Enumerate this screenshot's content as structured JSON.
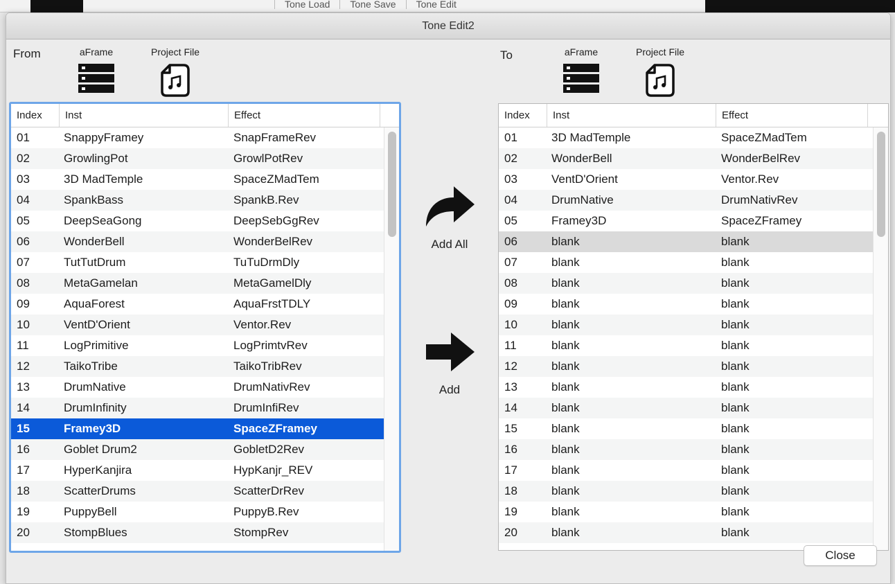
{
  "background": {
    "menu": [
      "Tone Load",
      "Tone Save",
      "Tone Edit"
    ]
  },
  "window": {
    "title": "Tone Edit2"
  },
  "from": {
    "label": "From",
    "aframe_label": "aFrame",
    "project_label": "Project File",
    "columns": [
      "Index",
      "Inst",
      "Effect"
    ],
    "selected_index": "15",
    "rows": [
      {
        "idx": "01",
        "inst": "SnappyFramey",
        "effect": "SnapFrameRev"
      },
      {
        "idx": "02",
        "inst": "GrowlingPot",
        "effect": "GrowlPotRev"
      },
      {
        "idx": "03",
        "inst": "3D MadTemple",
        "effect": "SpaceZMadTem"
      },
      {
        "idx": "04",
        "inst": "SpankBass",
        "effect": "SpankB.Rev"
      },
      {
        "idx": "05",
        "inst": "DeepSeaGong",
        "effect": "DeepSebGgRev"
      },
      {
        "idx": "06",
        "inst": "WonderBell",
        "effect": "WonderBelRev"
      },
      {
        "idx": "07",
        "inst": "TutTutDrum",
        "effect": "TuTuDrmDly"
      },
      {
        "idx": "08",
        "inst": "MetaGamelan",
        "effect": "MetaGamelDly"
      },
      {
        "idx": "09",
        "inst": "AquaForest",
        "effect": "AquaFrstTDLY"
      },
      {
        "idx": "10",
        "inst": "VentD'Orient",
        "effect": "Ventor.Rev"
      },
      {
        "idx": "11",
        "inst": "LogPrimitive",
        "effect": "LogPrimtvRev"
      },
      {
        "idx": "12",
        "inst": "TaikoTribe",
        "effect": "TaikoTribRev"
      },
      {
        "idx": "13",
        "inst": "DrumNative",
        "effect": "DrumNativRev"
      },
      {
        "idx": "14",
        "inst": "DrumInfinity",
        "effect": "DrumInfiRev"
      },
      {
        "idx": "15",
        "inst": "Framey3D",
        "effect": "SpaceZFramey"
      },
      {
        "idx": "16",
        "inst": "Goblet Drum2",
        "effect": "GobletD2Rev"
      },
      {
        "idx": "17",
        "inst": "HyperKanjira",
        "effect": "HypKanjr_REV"
      },
      {
        "idx": "18",
        "inst": "ScatterDrums",
        "effect": "ScatterDrRev"
      },
      {
        "idx": "19",
        "inst": "PuppyBell",
        "effect": "PuppyB.Rev"
      },
      {
        "idx": "20",
        "inst": "StompBlues",
        "effect": "StompRev"
      }
    ]
  },
  "to": {
    "label": "To",
    "aframe_label": "aFrame",
    "project_label": "Project File",
    "columns": [
      "Index",
      "Inst",
      "Effect"
    ],
    "highlighted_index": "06",
    "rows": [
      {
        "idx": "01",
        "inst": "3D MadTemple",
        "effect": "SpaceZMadTem"
      },
      {
        "idx": "02",
        "inst": "WonderBell",
        "effect": "WonderBelRev"
      },
      {
        "idx": "03",
        "inst": "VentD'Orient",
        "effect": "Ventor.Rev"
      },
      {
        "idx": "04",
        "inst": "DrumNative",
        "effect": "DrumNativRev"
      },
      {
        "idx": "05",
        "inst": "Framey3D",
        "effect": "SpaceZFramey"
      },
      {
        "idx": "06",
        "inst": "blank",
        "effect": "blank"
      },
      {
        "idx": "07",
        "inst": "blank",
        "effect": "blank"
      },
      {
        "idx": "08",
        "inst": "blank",
        "effect": "blank"
      },
      {
        "idx": "09",
        "inst": "blank",
        "effect": "blank"
      },
      {
        "idx": "10",
        "inst": "blank",
        "effect": "blank"
      },
      {
        "idx": "11",
        "inst": "blank",
        "effect": "blank"
      },
      {
        "idx": "12",
        "inst": "blank",
        "effect": "blank"
      },
      {
        "idx": "13",
        "inst": "blank",
        "effect": "blank"
      },
      {
        "idx": "14",
        "inst": "blank",
        "effect": "blank"
      },
      {
        "idx": "15",
        "inst": "blank",
        "effect": "blank"
      },
      {
        "idx": "16",
        "inst": "blank",
        "effect": "blank"
      },
      {
        "idx": "17",
        "inst": "blank",
        "effect": "blank"
      },
      {
        "idx": "18",
        "inst": "blank",
        "effect": "blank"
      },
      {
        "idx": "19",
        "inst": "blank",
        "effect": "blank"
      },
      {
        "idx": "20",
        "inst": "blank",
        "effect": "blank"
      }
    ]
  },
  "actions": {
    "add_all_label": "Add All",
    "add_label": "Add",
    "add_all_icon": "curved-arrow-right-icon",
    "add_icon": "arrow-right-icon"
  },
  "icons": {
    "aframe": "server-stack-icon",
    "project": "music-file-icon"
  },
  "close_label": "Close",
  "colors": {
    "selection": "#0b5ad9",
    "focus_ring": "#6ea6e8",
    "row_highlight": "#dadada"
  }
}
